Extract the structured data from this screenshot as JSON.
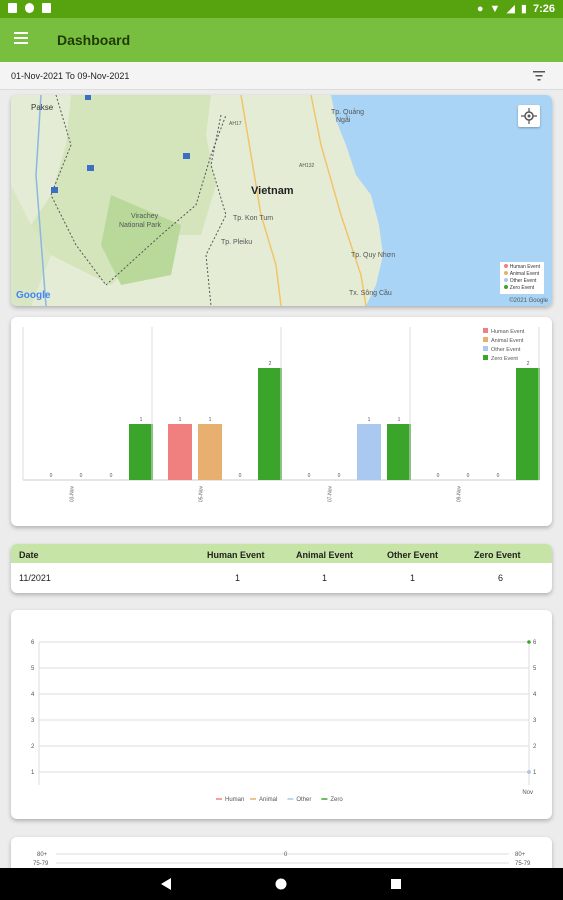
{
  "status_bar": {
    "time": "7:26"
  },
  "app_bar": {
    "title": "Dashboard",
    "menu_icon": "hamburger-menu-icon"
  },
  "date_bar": {
    "range": "01-Nov-2021 To 09-Nov-2021",
    "filter_icon": "filter-icon"
  },
  "map": {
    "labels": {
      "pakse": "Pakse",
      "vietnam": "Vietnam",
      "virachey": "Virachey",
      "virachey2": "National Park",
      "kon_tum": "Tp. Kon Tum",
      "pleiku": "Tp. Pleiku",
      "quang_ngai": "Tp. Quảng",
      "quang_ngai2": "Ngãi",
      "quy_nhon": "Tp. Quy Nhơn",
      "song_cau": "Tx. Sông Cầu",
      "ah17": "AH17",
      "road_1": "AH132"
    },
    "legend": [
      "Human Event",
      "Animal Event",
      "Other Event",
      "Zero Event"
    ],
    "google": "Google",
    "copyright": "©2021 Google"
  },
  "colors": {
    "human": "#f08080",
    "animal": "#e8b070",
    "other": "#aac8f0",
    "zero": "#3aa52a",
    "app_green": "#79bf3f",
    "table_header": "#c6e4a5"
  },
  "chart_data": [
    {
      "type": "bar",
      "categories": [
        "03-Nov",
        "05-Nov",
        "07-Nov",
        "09-Nov"
      ],
      "series": [
        {
          "name": "Human Event",
          "values": [
            0,
            1,
            0,
            0
          ]
        },
        {
          "name": "Animal Event",
          "values": [
            0,
            1,
            0,
            0
          ]
        },
        {
          "name": "Other Event",
          "values": [
            0,
            0,
            1,
            0
          ]
        },
        {
          "name": "Zero Event",
          "values": [
            1,
            2,
            1,
            2
          ]
        }
      ],
      "ylim": [
        0,
        2
      ],
      "legend": "top-right"
    },
    {
      "type": "line",
      "x": [
        "Nov"
      ],
      "series": [
        {
          "name": "Human",
          "values": [
            1
          ]
        },
        {
          "name": "Animal",
          "values": [
            1
          ]
        },
        {
          "name": "Other",
          "values": [
            1
          ]
        },
        {
          "name": "Zero",
          "values": [
            6
          ]
        }
      ],
      "yticks": [
        1,
        2,
        3,
        4,
        5,
        6
      ],
      "legend": "bottom"
    }
  ],
  "table": {
    "headers": [
      "Date",
      "Human Event",
      "Animal Event",
      "Other Event",
      "Zero Event"
    ],
    "rows": [
      [
        "11/2021",
        "1",
        "1",
        "1",
        "6"
      ]
    ]
  },
  "bottom_chart": {
    "left_top": "80+",
    "left_bottom": "75-79",
    "center": "0",
    "right_top": "80+",
    "right_bottom": "75-79"
  }
}
